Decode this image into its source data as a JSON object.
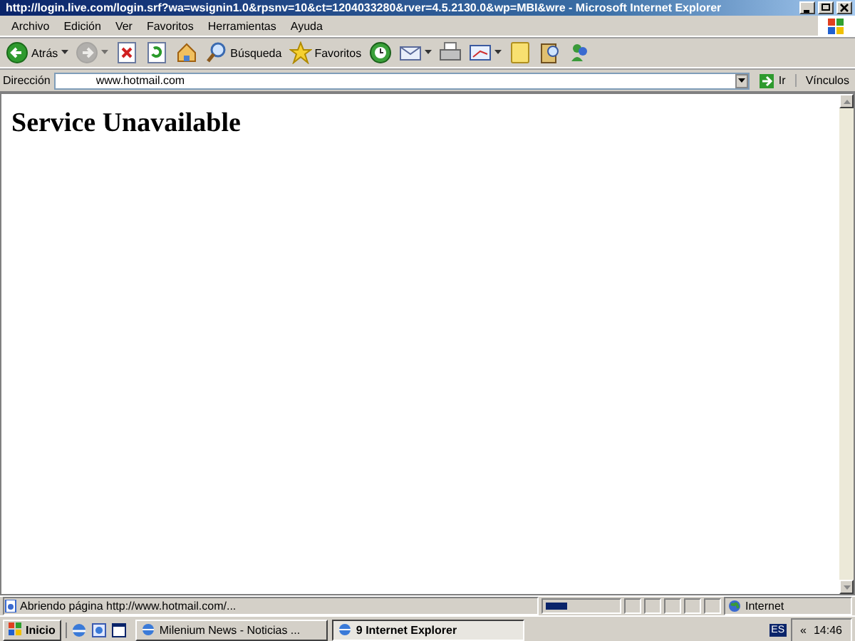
{
  "window": {
    "title": "http://login.live.com/login.srf?wa=wsignin1.0&rpsnv=10&ct=1204033280&rver=4.5.2130.0&wp=MBI&wre - Microsoft Internet Explorer"
  },
  "menu": [
    "Archivo",
    "Edición",
    "Ver",
    "Favoritos",
    "Herramientas",
    "Ayuda"
  ],
  "toolbar": [
    {
      "label": "Atrás",
      "dropdown": true,
      "disabled": false
    },
    {
      "dropdown": true,
      "disabled": true
    },
    {
      "dropdown": false,
      "disabled": false
    },
    {
      "dropdown": false,
      "disabled": false
    },
    {
      "dropdown": false,
      "disabled": false
    },
    {
      "label": "Búsqueda",
      "dropdown": false,
      "disabled": false
    },
    {
      "label": "Favoritos",
      "dropdown": false,
      "disabled": false
    },
    {
      "dropdown": false,
      "disabled": false
    },
    {
      "dropdown": true,
      "disabled": false
    },
    {
      "dropdown": false,
      "disabled": false
    },
    {
      "dropdown": true,
      "disabled": false
    },
    {
      "dropdown": false,
      "disabled": false
    },
    {
      "dropdown": false,
      "disabled": false
    },
    {
      "dropdown": false,
      "disabled": false
    }
  ],
  "address": {
    "label": "Dirección",
    "value": "www.hotmail.com",
    "go": "Ir",
    "links": "Vínculos"
  },
  "page": {
    "heading": "Service Unavailable"
  },
  "status": {
    "text": "Abriendo página http://www.hotmail.com/...",
    "progress": {
      "level": 0.3
    },
    "zone": "Internet"
  },
  "taskbar": {
    "start": "Inicio",
    "tasks": [
      {
        "label": "Milenium News - Noticias ...",
        "selected": false
      },
      {
        "label": "9 Internet Explorer",
        "selected": true
      }
    ],
    "language": "ES",
    "expand": "«",
    "clock": "14:46"
  }
}
